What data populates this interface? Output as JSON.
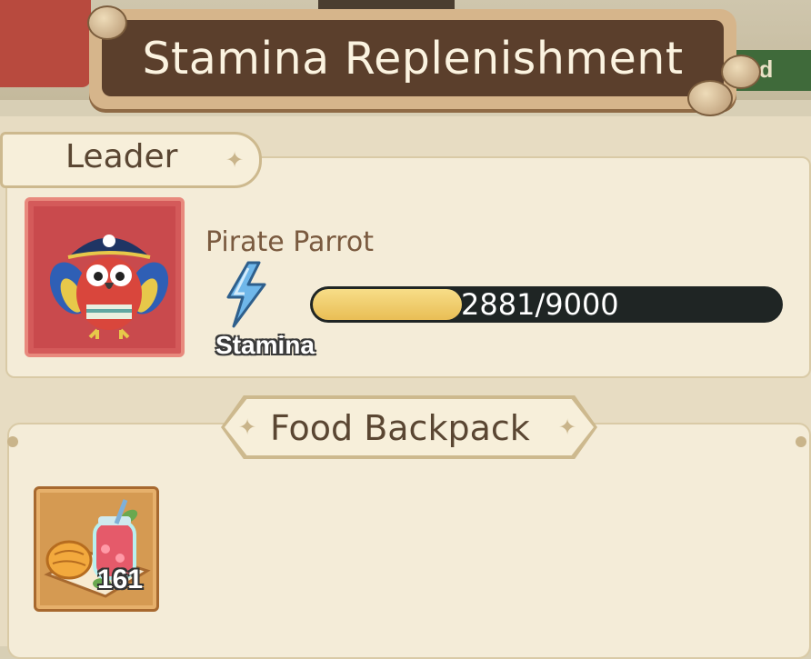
{
  "title": "Stamina Replenishment",
  "background_peek": {
    "partial_text": "ed"
  },
  "leader": {
    "section_label": "Leader",
    "pet_name": "Pirate Parrot",
    "stamina_label": "Stamina",
    "stamina_current": 2881,
    "stamina_max": 9000,
    "stamina_text": "2881/9000",
    "stamina_fraction": 0.32
  },
  "food_backpack": {
    "section_label": "Food Backpack",
    "items": [
      {
        "icon": "fruit-drink-food-icon",
        "count": "161"
      }
    ]
  },
  "colors": {
    "title_bg": "#5b3f2c",
    "stamina_fill": "#e9be55",
    "stamina_track": "#1f2524",
    "portrait_bg": "#c94a4d",
    "food_item_bg": "#d59a52"
  }
}
